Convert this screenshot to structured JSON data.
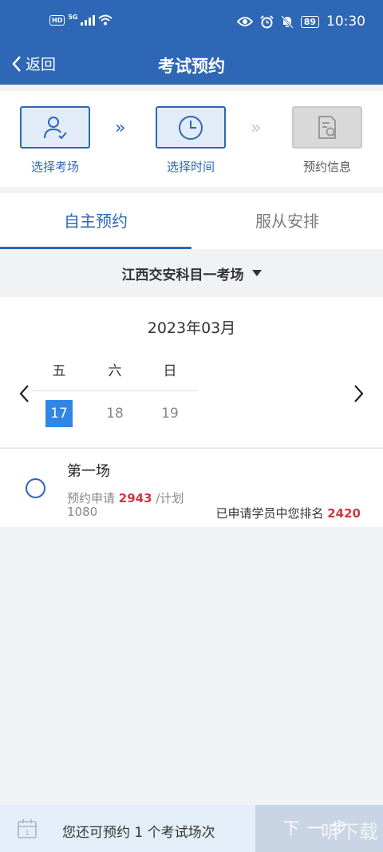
{
  "status_bar": {
    "hd": "HD",
    "network": "5G",
    "battery": "89",
    "time": "10:30"
  },
  "nav": {
    "back_label": "返回",
    "title": "考试预约"
  },
  "steps": [
    {
      "label": "选择考场",
      "icon": "user-check-icon"
    },
    {
      "label": "选择时间",
      "icon": "clock-icon"
    },
    {
      "label": "预约信息",
      "icon": "document-search-icon"
    }
  ],
  "tabs": [
    {
      "label": "自主预约",
      "active": true
    },
    {
      "label": "服从安排",
      "active": false
    }
  ],
  "venue": {
    "name": "江西交安科目一考场"
  },
  "calendar": {
    "month": "2023年03月",
    "weekdays": [
      "五",
      "六",
      "日"
    ],
    "days": [
      "17",
      "18",
      "19"
    ],
    "selected_day": "17"
  },
  "session": {
    "title": "第一场",
    "applied_label": "预约申请",
    "applied_count": "2943",
    "plan_label": "/计划",
    "plan_count": "1080",
    "rank_label": "已申请学员中您排名",
    "rank_value": "2420"
  },
  "bottom": {
    "remaining_text": "您还可预约 1 个考试场次",
    "next_label": "下一步",
    "watermark": "听下载"
  },
  "colors": {
    "primary": "#2d67b5",
    "selected_day": "#2f86e6",
    "highlight_red": "#d0373f"
  }
}
